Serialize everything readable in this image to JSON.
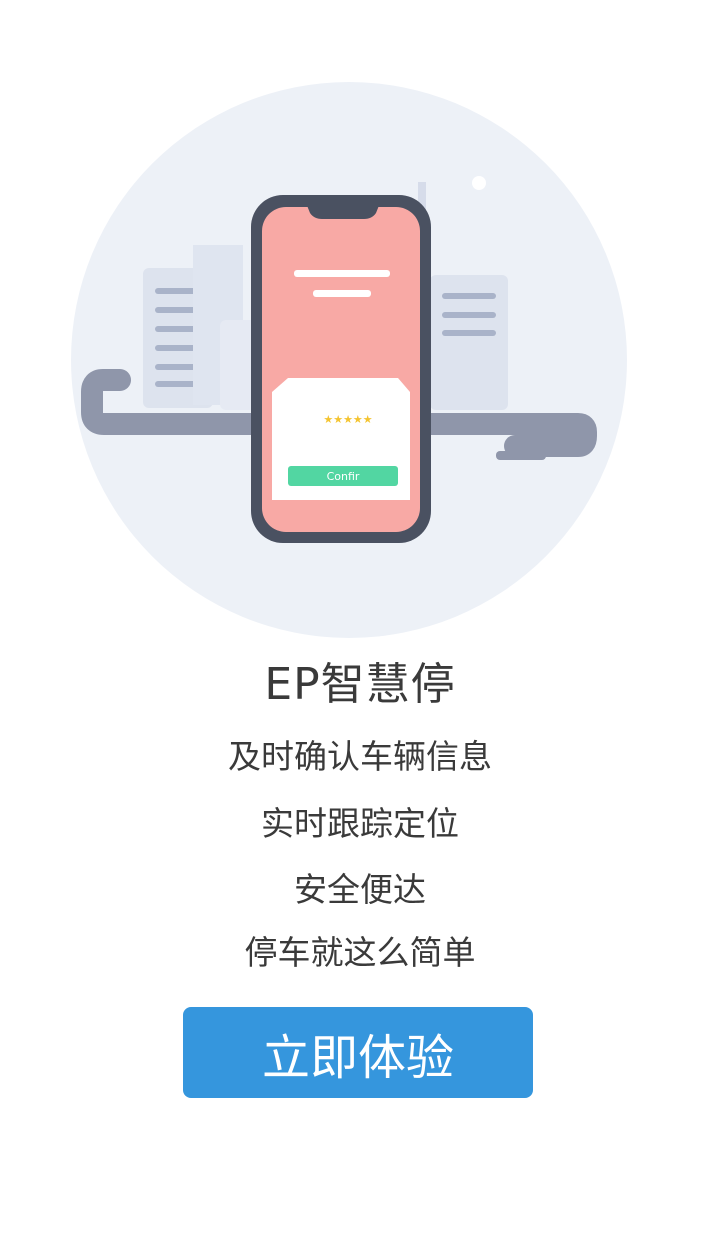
{
  "illustration": {
    "icon": "phone-parking-illustration-icon",
    "dialog_stars": "★★★★★",
    "dialog_button": "Confir",
    "colors": {
      "circle": "#edf1f7",
      "phone_screen": "#f8a9a5",
      "phone_body": "#4a5161",
      "road": "#8f96aa",
      "confirm": "#52d6a2"
    }
  },
  "app_title": "EP智慧停",
  "taglines": [
    "及时确认车辆信息",
    "实时跟踪定位",
    "安全便达",
    "停车就这么简单"
  ],
  "cta": {
    "label": "立即体验",
    "color": "#3596dd"
  }
}
